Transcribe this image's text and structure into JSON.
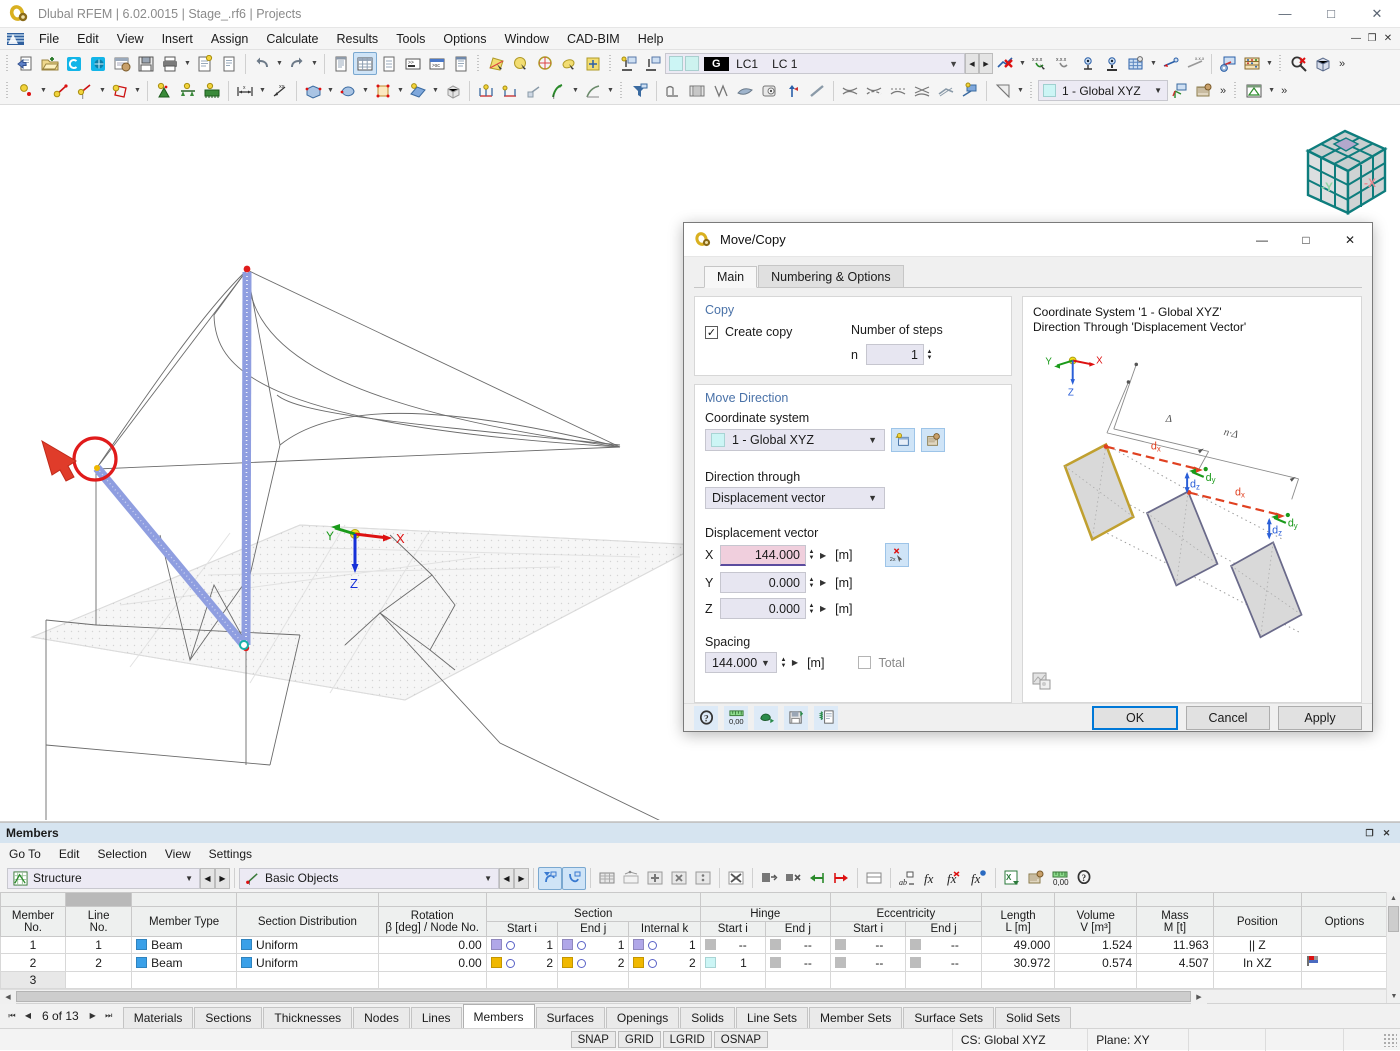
{
  "window": {
    "title": "Dlubal RFEM | 6.02.0015 | Stage_.rf6 | Projects",
    "minimize": "—",
    "maximize": "□",
    "close": "✕"
  },
  "menu": {
    "items": [
      "File",
      "Edit",
      "View",
      "Insert",
      "Assign",
      "Calculate",
      "Results",
      "Tools",
      "Options",
      "Window",
      "CAD-BIM",
      "Help"
    ],
    "mdi": [
      "—",
      "❐",
      "✕"
    ]
  },
  "toolbar": {
    "load_case": {
      "tag": "G",
      "code": "LC1",
      "name": "LC 1"
    },
    "coordinate_system": "1 - Global XYZ",
    "overflow": "»"
  },
  "viewport": {
    "axes": {
      "x": "X",
      "y": "Y",
      "z": "Z"
    },
    "viewcube": {
      "left_face": "-Y",
      "right_face": "-X"
    }
  },
  "dialog": {
    "title": "Move/Copy",
    "minimize": "—",
    "maximize": "□",
    "close": "✕",
    "tabs": [
      {
        "label": "Main",
        "active": true
      },
      {
        "label": "Numbering & Options",
        "active": false
      }
    ],
    "copy": {
      "group_label": "Copy",
      "create_copy_label": "Create copy",
      "create_copy_checked": "✓",
      "number_of_steps_label": "Number of steps",
      "n_label": "n",
      "n_value": "1"
    },
    "move_direction": {
      "group_label": "Move Direction",
      "coordinate_system_label": "Coordinate system",
      "coordinate_system_value": "1 - Global XYZ",
      "direction_through_label": "Direction through",
      "direction_through_value": "Displacement vector",
      "displacement_vector_label": "Displacement vector",
      "rows": [
        {
          "axis": "X",
          "value": "144.000",
          "unit": "[m]",
          "focused": true
        },
        {
          "axis": "Y",
          "value": "0.000",
          "unit": "[m]",
          "focused": false
        },
        {
          "axis": "Z",
          "value": "0.000",
          "unit": "[m]",
          "focused": false
        }
      ],
      "spacing_label": "Spacing",
      "spacing_value": "144.000",
      "spacing_unit": "[m]",
      "total_label": "Total"
    },
    "preview": {
      "line1": "Coordinate System '1 - Global XYZ'",
      "line2": "Direction Through 'Displacement Vector'",
      "axes": {
        "x": "X",
        "y": "Y",
        "z": "Z"
      },
      "labels": {
        "delta": "Δ",
        "n_delta": "n·Δ",
        "dx": "d",
        "dx_sub": "x",
        "dy": "d",
        "dy_sub": "y",
        "dz": "d",
        "dz_sub": "z"
      }
    },
    "buttons": {
      "ok": "OK",
      "cancel": "Cancel",
      "apply": "Apply"
    }
  },
  "members_panel": {
    "title": "Members",
    "menu": [
      "Go To",
      "Edit",
      "Selection",
      "View",
      "Settings"
    ],
    "combo_structure": "Structure",
    "combo_objects": "Basic Objects",
    "table": {
      "group_headers": [
        {
          "label": "",
          "span": 1
        },
        {
          "label": "",
          "span": 1
        },
        {
          "label": "",
          "span": 1
        },
        {
          "label": "",
          "span": 1
        },
        {
          "label": "",
          "span": 1
        },
        {
          "label": "Section",
          "span": 3
        },
        {
          "label": "Hinge",
          "span": 2
        },
        {
          "label": "Eccentricity",
          "span": 2
        },
        {
          "label": "",
          "span": 1
        },
        {
          "label": "",
          "span": 1
        },
        {
          "label": "",
          "span": 1
        },
        {
          "label": "",
          "span": 1
        },
        {
          "label": "",
          "span": 1
        }
      ],
      "columns": [
        {
          "l1": "Member",
          "l2": "No."
        },
        {
          "l1": "Line",
          "l2": "No."
        },
        {
          "l1": "",
          "l2": "Member Type"
        },
        {
          "l1": "",
          "l2": "Section Distribution"
        },
        {
          "l1": "Rotation",
          "l2": "β [deg] / Node No."
        },
        {
          "l1": "Section",
          "l2": "Start i"
        },
        {
          "l1": "Section",
          "l2": "End j"
        },
        {
          "l1": "Section",
          "l2": "Internal k"
        },
        {
          "l1": "Hinge",
          "l2": "Start i"
        },
        {
          "l1": "Hinge",
          "l2": "End j"
        },
        {
          "l1": "Eccentricity",
          "l2": "Start i"
        },
        {
          "l1": "Eccentricity",
          "l2": "End j"
        },
        {
          "l1": "Length",
          "l2": "L [m]"
        },
        {
          "l1": "Volume",
          "l2": "V [m³]"
        },
        {
          "l1": "Mass",
          "l2": "M [t]"
        },
        {
          "l1": "",
          "l2": "Position"
        },
        {
          "l1": "",
          "l2": "Options"
        }
      ],
      "rows": [
        {
          "member_no": "1",
          "line_no": "1",
          "member_type": "Beam",
          "member_type_color": "#3aa0e8",
          "section_distribution": "Uniform",
          "section_distribution_color": "#3aa0e8",
          "rotation": "0.00",
          "sec_start": "1",
          "sec_start_color": "#b0a7e8",
          "sec_end": "1",
          "sec_end_color": "#b0a7e8",
          "sec_internal": "1",
          "sec_internal_color": "#b0a7e8",
          "hinge_start": "--",
          "hinge_end": "--",
          "ecc_start": "--",
          "ecc_end": "--",
          "length": "49.000",
          "volume": "1.524",
          "mass": "11.963",
          "position": "|| Z",
          "options": ""
        },
        {
          "member_no": "2",
          "line_no": "2",
          "member_type": "Beam",
          "member_type_color": "#3aa0e8",
          "section_distribution": "Uniform",
          "section_distribution_color": "#3aa0e8",
          "rotation": "0.00",
          "sec_start": "2",
          "sec_start_color": "#f0b800",
          "sec_end": "2",
          "sec_end_color": "#f0b800",
          "sec_internal": "2",
          "sec_internal_color": "#f0b800",
          "hinge_start": "1",
          "hinge_end": "--",
          "ecc_start": "--",
          "ecc_end": "--",
          "length": "30.972",
          "volume": "0.574",
          "mass": "4.507",
          "position": "In XZ",
          "options": "flag"
        },
        {
          "member_no": "3",
          "line_no": "",
          "member_type": "",
          "section_distribution": "",
          "rotation": "",
          "sec_start": "",
          "sec_end": "",
          "sec_internal": "",
          "hinge_start": "",
          "hinge_end": "",
          "ecc_start": "",
          "ecc_end": "",
          "length": "",
          "volume": "",
          "mass": "",
          "position": "",
          "options": ""
        }
      ]
    }
  },
  "bottom_tabs": {
    "page_indicator": "6 of 13",
    "items": [
      {
        "label": "Materials",
        "active": false
      },
      {
        "label": "Sections",
        "active": false
      },
      {
        "label": "Thicknesses",
        "active": false
      },
      {
        "label": "Nodes",
        "active": false
      },
      {
        "label": "Lines",
        "active": false
      },
      {
        "label": "Members",
        "active": true
      },
      {
        "label": "Surfaces",
        "active": false
      },
      {
        "label": "Openings",
        "active": false
      },
      {
        "label": "Solids",
        "active": false
      },
      {
        "label": "Line Sets",
        "active": false
      },
      {
        "label": "Member Sets",
        "active": false
      },
      {
        "label": "Surface Sets",
        "active": false
      },
      {
        "label": "Solid Sets",
        "active": false
      }
    ]
  },
  "status_bar": {
    "snap_buttons": [
      "SNAP",
      "GRID",
      "LGRID",
      "OSNAP"
    ],
    "cs": "CS: Global XYZ",
    "plane": "Plane: XY"
  },
  "colors": {
    "accent_blue": "#0078d7",
    "group_label": "#4a72a8",
    "beam": "#3aa0e8",
    "section1": "#b0a7e8",
    "section2": "#f0b800",
    "member_line": "#8f9ee0",
    "highlight_red": "#e01b1b"
  }
}
